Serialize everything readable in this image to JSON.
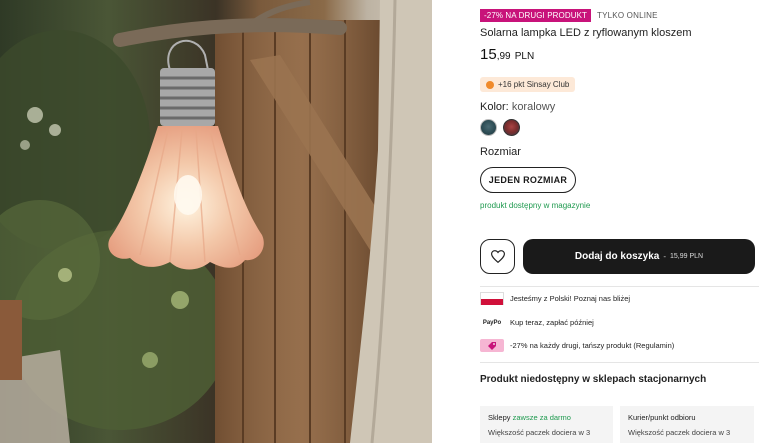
{
  "product": {
    "promo_badge": "-27% NA DRUGI PRODUKT",
    "online_badge": "TYLKO ONLINE",
    "title": "Solarna lampka LED z ryflowanym kloszem",
    "price_int": "15",
    "price_dec": ",99",
    "currency": "PLN",
    "club_text": "+16 pkt Sinsay Club",
    "color_label": "Kolor:",
    "color_value": "koralowy",
    "size_label": "Rozmiar",
    "size_button": "JEDEN ROZMIAR",
    "stock": "produkt dostępny w magazynie",
    "add_to_cart": "Dodaj do koszyka",
    "cart_separator": "-",
    "cart_price": "15,99 PLN"
  },
  "features": [
    {
      "icon": "flag-poland-icon",
      "text": "Jesteśmy z Polski! Poznaj nas bliżej"
    },
    {
      "icon": "paypo-icon",
      "icon_text": "PayPo",
      "text": "Kup teraz, zapłać później"
    },
    {
      "icon": "promo-tag-icon",
      "text": "-27% na każdy drugi, tańszy produkt (Regulamin)"
    }
  ],
  "availability": {
    "heading": "Produkt niedostępny w sklepach stacjonarnych"
  },
  "delivery": [
    {
      "title": "Sklepy",
      "highlight": "zawsze za darmo",
      "subtitle": "Większość paczek dociera w 3"
    },
    {
      "title": "Kurier/punkt odbioru",
      "highlight": "",
      "subtitle": "Większość paczek dociera w 3"
    }
  ],
  "colors": {
    "promo": "#c8137a",
    "stock_green": "#1f9a4f",
    "cart_bg": "#1a1a1a",
    "club_bg": "#fde9d8"
  }
}
